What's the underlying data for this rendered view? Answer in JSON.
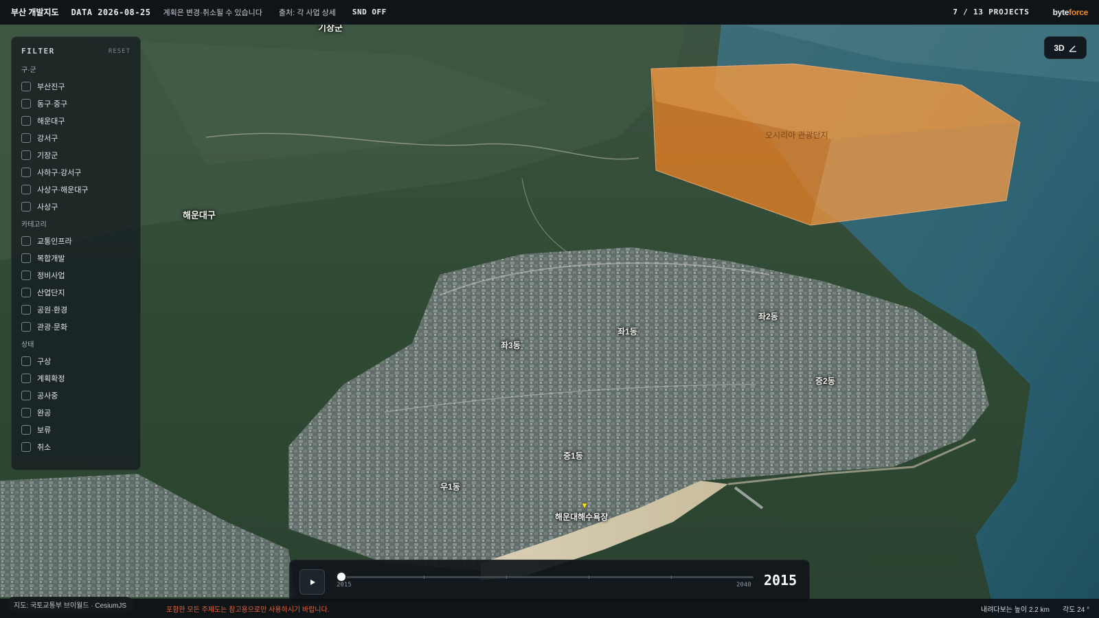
{
  "topbar": {
    "brand": "부산 개발지도",
    "date": "DATA 2026-08-25",
    "notice": "계획은 변경·취소될 수 있습니다",
    "source": "출처: 각 사업 상세",
    "sound": "SND OFF",
    "projects": "7 / 13 PROJECTS",
    "logo_main": "byte",
    "logo_accent": "force"
  },
  "filter": {
    "title": "FILTER",
    "reset": "RESET",
    "sections": [
      {
        "label": "구·군",
        "items": [
          "부산진구",
          "동구·중구",
          "해운대구",
          "강서구",
          "기장군",
          "사하구·강서구",
          "사상구·해운대구",
          "사상구"
        ]
      },
      {
        "label": "카테고리",
        "items": [
          "교통인프라",
          "복합개발",
          "정비사업",
          "산업단지",
          "공원·환경",
          "관광·문화"
        ]
      },
      {
        "label": "상태",
        "items": [
          "구상",
          "계획확정",
          "공사중",
          "완공",
          "보류",
          "취소"
        ]
      }
    ]
  },
  "view_toggle": {
    "label": "3D"
  },
  "map": {
    "labels": {
      "gijang": "기장군",
      "haeundae_gu": "해운대구",
      "jwa1": "좌1동",
      "jwa2": "좌2동",
      "jwa3": "좌3동",
      "jung1": "중1동",
      "jung2": "중2동",
      "u1": "우1동",
      "beach": "해운대해수욕장",
      "project_polygon": "오시리아 관광단지"
    },
    "project_color": "#f08a2a"
  },
  "timeline": {
    "start": "2015",
    "end": "2040",
    "current": "2015",
    "progress": 0
  },
  "footer": {
    "attribution": "지도: 국토교통부 브이월드 · CesiumJS",
    "disclaimer": "포함한 모든 주제도는 참고용으로만 사용하시기 바랍니다.",
    "altitude": "내려다보는 높이 2.2 km",
    "tilt": "각도 24 °"
  }
}
